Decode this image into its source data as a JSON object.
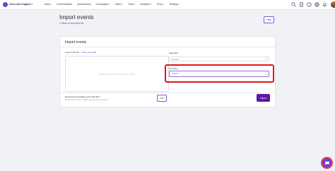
{
  "header": {
    "workspace": "User.com Support",
    "nav": [
      "Data",
      "Conversations",
      "Automations",
      "Campaigns",
      "Sales",
      "Tools",
      "Analytics",
      "Docs",
      "Settings"
    ],
    "nav_with_chevron": [
      true,
      false,
      false,
      true,
      true,
      true,
      true,
      true,
      true
    ]
  },
  "page": {
    "title": "Import events",
    "back_link": "Back to importers list",
    "help_button": "Help"
  },
  "form": {
    "card_title": "Import events",
    "import_label": "Import CSV file",
    "paste_link": "Paste your data",
    "dropzone_text": "Drag and drop a CSV file here or click",
    "separator_label": "Separator",
    "separator_value": "comma",
    "encoding_label": "Encoding",
    "encoding_value": "UTF-8",
    "help_heading": "Need help formatting your CSV file?",
    "help_subtext": "Download our CSV template and see how to format it",
    "csv_button": "CSV",
    "import_button": "Import"
  },
  "colors": {
    "accent": "#6e3fd6",
    "primary_button": "#5b17a6",
    "highlight": "#e01818"
  },
  "icons": [
    "search-icon",
    "document-icon",
    "help-icon",
    "globe-icon",
    "notifications-icon",
    "chat-icon"
  ]
}
